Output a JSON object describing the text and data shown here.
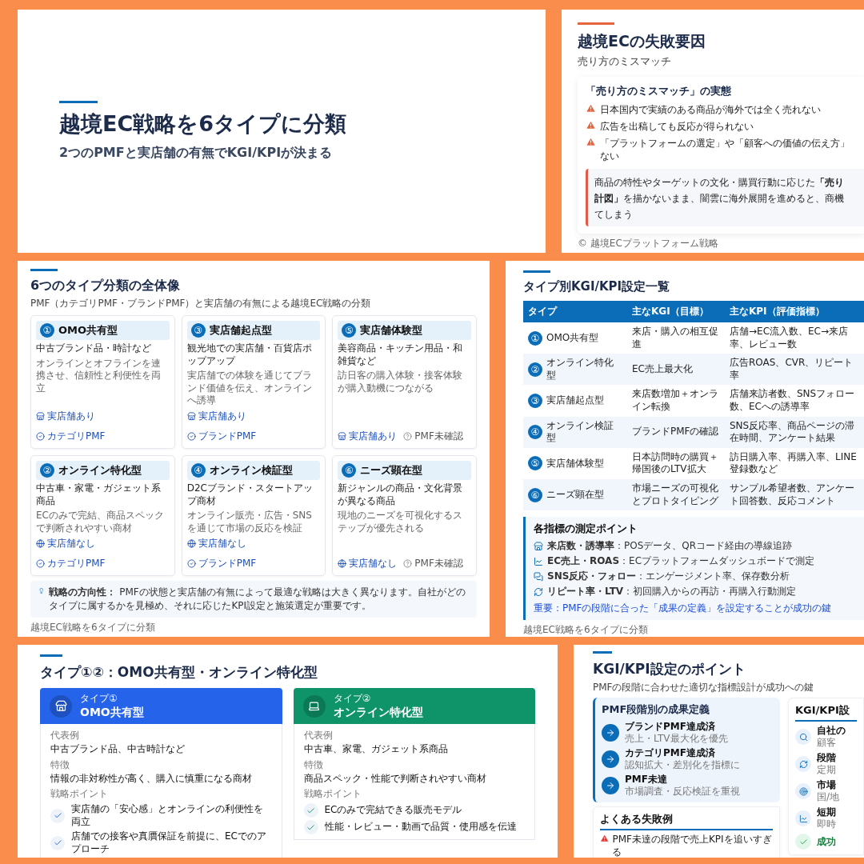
{
  "cover": {
    "title": "越境EC戦略を6タイプに分類",
    "subtitle": "2つのPMFと実店舗の有無でKGI/KPIが決まる"
  },
  "failure_slide": {
    "title": "越境ECの失敗要因",
    "subtitle": "売り方のミスマッチ",
    "card_title": "「売り方のミスマッチ」の実態",
    "warnings": [
      {
        "lines": [
          "日本国内で実績のある商品が海外では全く売れない"
        ]
      },
      {
        "lines": [
          "広告を出稿しても反応が得られない"
        ]
      },
      {
        "lines": [
          "「プラットフォームの選定」や「顧客への価値の伝え方」",
          "ない"
        ]
      }
    ],
    "callout_lines": [
      "商品の特性やターゲットの文化・購買行動に応じた**「売り**",
      "**計図」**を描かないまま、闇雲に海外展開を進めると、商機",
      "てしまう"
    ],
    "footer": "© 越境ECプラットフォーム戦略"
  },
  "overview_slide": {
    "title": "6つのタイプ分類の全体像",
    "subtitle": "PMF（カテゴリPMF・ブランドPMF）と実店舗の有無による越境EC戦略の分類",
    "cards": [
      {
        "num": "①",
        "name": "OMO共有型",
        "examples": "中古ブランド品・時計など",
        "description": "オンラインとオフラインを連携させ、信頼性と利便性を両立",
        "tags": [
          {
            "kind": "store",
            "label": "実店舗あり"
          },
          {
            "kind": "pmf",
            "label": "カテゴリPMF"
          }
        ]
      },
      {
        "num": "③",
        "name": "実店舗起点型",
        "examples": "観光地での実店舗・百貨店ポップアップ",
        "description": "実店舗での体験を通じてブランド価値を伝え、オンラインへ誘導",
        "tags": [
          {
            "kind": "store",
            "label": "実店舗あり"
          },
          {
            "kind": "pmf",
            "label": "ブランドPMF"
          }
        ]
      },
      {
        "num": "⑤",
        "name": "実店舗体験型",
        "examples": "美容商品・キッチン用品・和雑貨など",
        "description": "訪日客の購入体験・接客体験が購入動機につながる",
        "tags": [
          {
            "kind": "store",
            "label": "実店舗あり"
          },
          {
            "kind": "unconfirmed",
            "label": "PMF未確認"
          }
        ]
      },
      {
        "num": "②",
        "name": "オンライン特化型",
        "examples": "中古車・家電・ガジェット系商品",
        "description": "ECのみで完結、商品スペックで判断されやすい商材",
        "tags": [
          {
            "kind": "online",
            "label": "実店舗なし"
          },
          {
            "kind": "pmf",
            "label": "カテゴリPMF"
          }
        ]
      },
      {
        "num": "④",
        "name": "オンライン検証型",
        "examples": "D2Cブランド・スタートアップ商材",
        "description": "オンライン販売・広告・SNSを通じて市場の反応を検証",
        "tags": [
          {
            "kind": "online",
            "label": "実店舗なし"
          },
          {
            "kind": "pmf",
            "label": "ブランドPMF"
          }
        ]
      },
      {
        "num": "⑥",
        "name": "ニーズ顕在型",
        "examples": "新ジャンルの商品・文化背景が異なる商品",
        "description": "現地のニーズを可視化するステップが優先される",
        "tags": [
          {
            "kind": "online",
            "label": "実店舗なし"
          },
          {
            "kind": "unconfirmed",
            "label": "PMF未確認"
          }
        ]
      }
    ],
    "note": "**戦略の方向性：** PMFの状態と実店舗の有無によって最適な戦略は大きく異なります。自社がどのタイプに属するかを見極め、それに応じたKPI設定と施策選定が重要です。",
    "footer": "越境EC戦略を6タイプに分類"
  },
  "kpi_table_slide": {
    "title": "タイプ別KGI/KPI設定一覧",
    "columns": [
      "タイプ",
      "主なKGI（目標）",
      "主なKPI（評価指標）"
    ],
    "rows": [
      {
        "num": "①",
        "type": "OMO共有型",
        "kgi": "来店・購入の相互促進",
        "kpi": "店舗→EC流入数、EC→来店率、レビュー数"
      },
      {
        "num": "②",
        "type": "オンライン特化型",
        "kgi": "EC売上最大化",
        "kpi": "広告ROAS、CVR、リピート率"
      },
      {
        "num": "③",
        "type": "実店舗起点型",
        "kgi": "来店数増加＋オンライン転換",
        "kpi": "店舗来訪者数、SNSフォロー数、ECへの誘導率"
      },
      {
        "num": "④",
        "type": "オンライン検証型",
        "kgi": "ブランドPMFの確認",
        "kpi": "SNS反応率、商品ページの滞在時間、アンケート結果"
      },
      {
        "num": "⑤",
        "type": "実店舗体験型",
        "kgi": "日本訪問時の購買＋帰国後のLTV拡大",
        "kpi": "訪日購入率、再購入率、LINE登録数など"
      },
      {
        "num": "⑥",
        "type": "ニーズ顕在型",
        "kgi": "市場ニーズの可視化とプロトタイピング",
        "kpi": "サンプル希望者数、アンケート回答数、反応コメント"
      }
    ],
    "measure": {
      "title": "各指標の測定ポイント",
      "points": [
        {
          "kind": "store",
          "text": "**来店数・誘導率**：POSデータ、QRコード経由の導線追跡"
        },
        {
          "kind": "chart",
          "text": "**EC売上・ROAS**：ECプラットフォームダッシュボードで測定"
        },
        {
          "kind": "chat",
          "text": "**SNS反応・フォロー**：エンゲージメント率、保存数分析"
        },
        {
          "kind": "repeat",
          "text": "**リピート率・LTV**：初回購入からの再訪・再購入行動測定"
        }
      ],
      "key_note": "重要：PMFの段階に合った「成果の定義」を設定することが成功の鍵"
    },
    "footer": "越境EC戦略を6タイプに分類"
  },
  "type_detail_slide": {
    "title": "タイプ①②：OMO共有型・オンライン特化型",
    "cards": [
      {
        "kind": "store",
        "color": "#2563eb",
        "type_label": "タイプ①",
        "name": "OMO共有型",
        "sections": [
          {
            "label": "代表例",
            "text": "中古ブランド品、中古時計など"
          },
          {
            "label": "特徴",
            "text": "情報の非対称性が高く、購入に慎重になる商材"
          }
        ],
        "points_label": "戦略ポイント",
        "points": [
          "実店舗の「安心感」とオンラインの利便性を両立",
          "店舗での接客や真贋保証を前提に、ECでのアプローチ"
        ]
      },
      {
        "kind": "laptop",
        "color": "#0e9468",
        "type_label": "タイプ②",
        "name": "オンライン特化型",
        "sections": [
          {
            "label": "代表例",
            "text": "中古車、家電、ガジェット系商品"
          },
          {
            "label": "特徴",
            "text": "商品スペック・性能で判断されやすい商材"
          }
        ],
        "points_label": "戦略ポイント",
        "points": [
          "ECのみで完結できる販売モデル",
          "性能・レビュー・動画で品質・使用感を伝達"
        ]
      }
    ]
  },
  "kpi_points_slide": {
    "title": "KGI/KPI設定のポイント",
    "subtitle": "PMFの段階に合わせた適切な指標設計が成功への鍵",
    "stage_card": {
      "title": "PMF段階別の成果定義",
      "stages": [
        {
          "name": "ブランドPMF達成済",
          "note": "売上・LTV最大化を優先"
        },
        {
          "name": "カテゴリPMF達成済",
          "note": "認知拡大・差別化を指標に"
        },
        {
          "name": "PMF未達",
          "note": "市場調査・反応検証を重視"
        }
      ]
    },
    "failure_card": {
      "title": "よくある失敗例",
      "items": [
        "PMF未達の段階で売上KPIを追いすぎる"
      ]
    },
    "side_card": {
      "title": "KGI/KPI設",
      "items": [
        {
          "kind": "search",
          "name": "自社の",
          "note": "顧客"
        },
        {
          "kind": "cycle",
          "name": "段階",
          "note": "定期"
        },
        {
          "kind": "target",
          "name": "市場",
          "note": "国/地"
        },
        {
          "kind": "chart",
          "name": "短期",
          "note": "即時"
        },
        {
          "kind": "check",
          "name": "成功"
        }
      ]
    }
  }
}
